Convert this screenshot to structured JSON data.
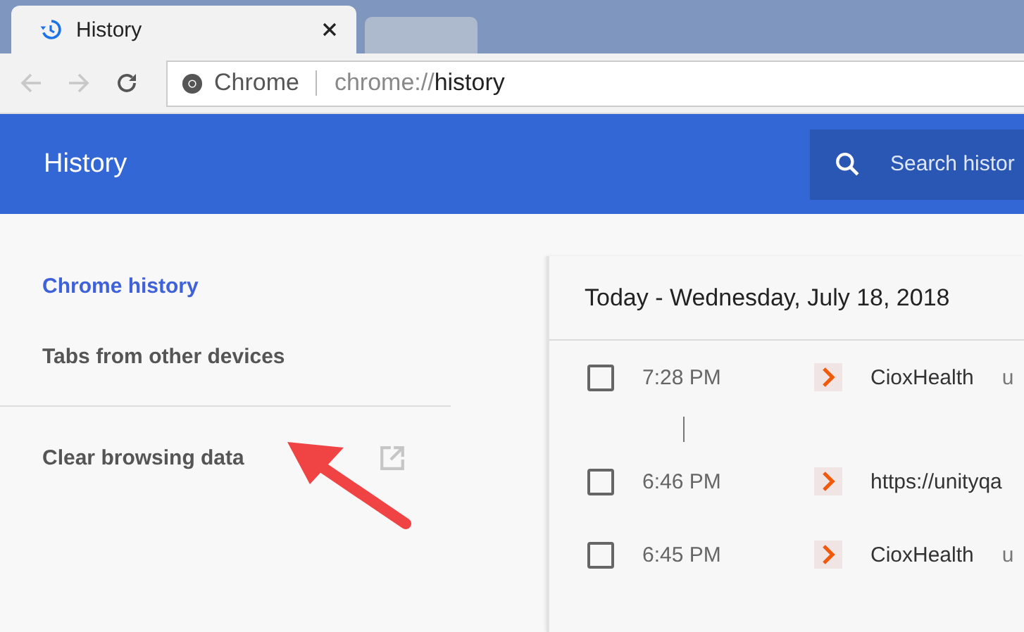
{
  "tabs": [
    {
      "label": "History",
      "selected": true
    },
    {
      "selected": false
    }
  ],
  "toolbar": {
    "back_disabled": true,
    "forward_disabled": true
  },
  "address": {
    "site": "Chrome",
    "scheme": "chrome://",
    "path": "history"
  },
  "header": {
    "title": "History",
    "search_placeholder": "Search histor"
  },
  "sidebar": {
    "items": [
      {
        "label": "Chrome history",
        "selected": true,
        "kind": "link"
      },
      {
        "label": "Tabs from other devices",
        "selected": false,
        "kind": "link"
      },
      {
        "label": "Clear browsing data",
        "selected": false,
        "kind": "external"
      }
    ]
  },
  "day": {
    "heading": "Today - Wednesday, July 18, 2018",
    "entries": [
      {
        "time": "7:28 PM",
        "title": "CioxHealth",
        "domain": "u",
        "checked": false,
        "gap_after": true
      },
      {
        "time": "6:46 PM",
        "title": "https://unityqa",
        "checked": false,
        "gap_after": false
      },
      {
        "time": "6:45 PM",
        "title": "CioxHealth",
        "domain": "u",
        "checked": false,
        "gap_after": false
      }
    ]
  }
}
